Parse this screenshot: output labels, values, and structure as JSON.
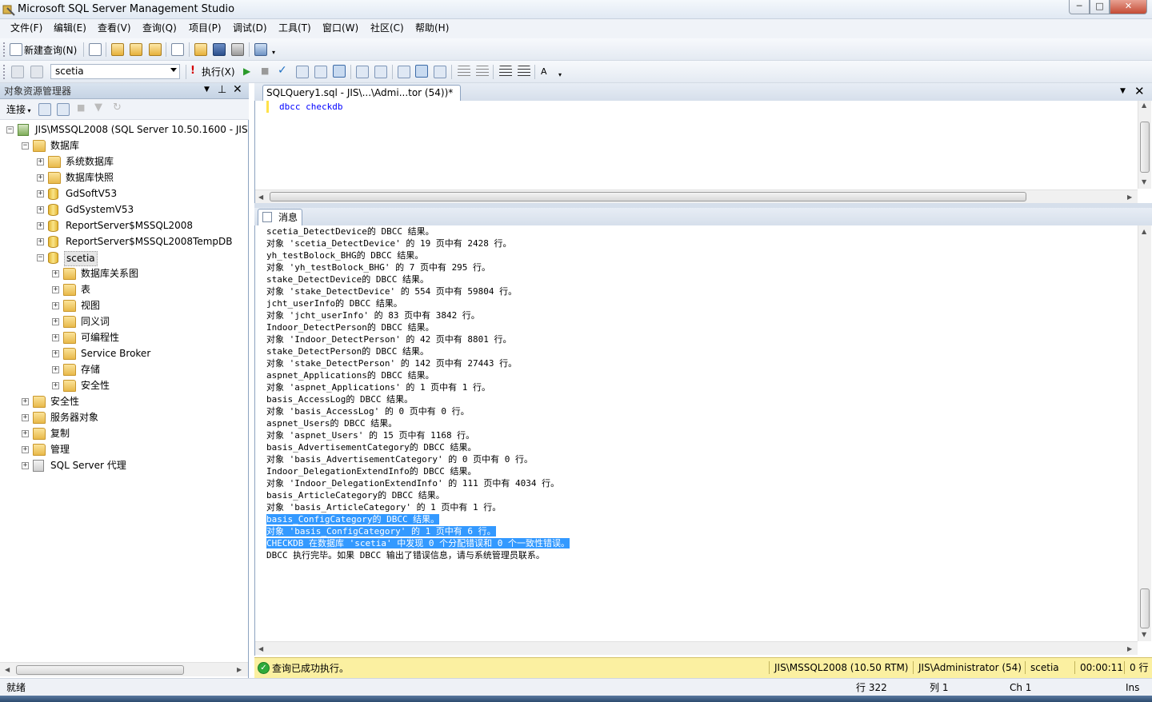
{
  "window": {
    "title": "Microsoft SQL Server Management Studio",
    "min": "─",
    "max": "□",
    "close": "✕"
  },
  "menu": [
    "文件(F)",
    "编辑(E)",
    "查看(V)",
    "查询(Q)",
    "项目(P)",
    "调试(D)",
    "工具(T)",
    "窗口(W)",
    "社区(C)",
    "帮助(H)"
  ],
  "toolbar1": {
    "new_query": "新建查询(N)"
  },
  "toolbar2": {
    "database": "scetia",
    "execute": "执行(X)"
  },
  "object_explorer": {
    "title": "对象资源管理器",
    "connect": "连接",
    "tree": [
      {
        "label": "JIS\\MSSQL2008 (SQL Server 10.50.1600 - JIS\\",
        "level": 0,
        "icon": "server-icon",
        "exp": "−"
      },
      {
        "label": "数据库",
        "level": 1,
        "icon": "folder-icon",
        "exp": "−"
      },
      {
        "label": "系统数据库",
        "level": 2,
        "icon": "folder-icon",
        "exp": "+"
      },
      {
        "label": "数据库快照",
        "level": 2,
        "icon": "folder-icon",
        "exp": "+"
      },
      {
        "label": "GdSoftV53",
        "level": 2,
        "icon": "database-icon",
        "exp": "+"
      },
      {
        "label": "GdSystemV53",
        "level": 2,
        "icon": "database-icon",
        "exp": "+"
      },
      {
        "label": "ReportServer$MSSQL2008",
        "level": 2,
        "icon": "database-icon",
        "exp": "+"
      },
      {
        "label": "ReportServer$MSSQL2008TempDB",
        "level": 2,
        "icon": "database-icon",
        "exp": "+"
      },
      {
        "label": "scetia",
        "level": 2,
        "icon": "database-icon",
        "exp": "−",
        "selected": true
      },
      {
        "label": "数据库关系图",
        "level": 3,
        "icon": "folder-icon",
        "exp": "+"
      },
      {
        "label": "表",
        "level": 3,
        "icon": "folder-icon",
        "exp": "+"
      },
      {
        "label": "视图",
        "level": 3,
        "icon": "folder-icon",
        "exp": "+"
      },
      {
        "label": "同义词",
        "level": 3,
        "icon": "folder-icon",
        "exp": "+"
      },
      {
        "label": "可编程性",
        "level": 3,
        "icon": "folder-icon",
        "exp": "+"
      },
      {
        "label": "Service Broker",
        "level": 3,
        "icon": "folder-icon",
        "exp": "+"
      },
      {
        "label": "存储",
        "level": 3,
        "icon": "folder-icon",
        "exp": "+"
      },
      {
        "label": "安全性",
        "level": 3,
        "icon": "folder-icon",
        "exp": "+"
      },
      {
        "label": "安全性",
        "level": 1,
        "icon": "folder-icon",
        "exp": "+"
      },
      {
        "label": "服务器对象",
        "level": 1,
        "icon": "folder-icon",
        "exp": "+"
      },
      {
        "label": "复制",
        "level": 1,
        "icon": "folder-icon",
        "exp": "+"
      },
      {
        "label": "管理",
        "level": 1,
        "icon": "folder-icon",
        "exp": "+"
      },
      {
        "label": "SQL Server 代理",
        "level": 1,
        "icon": "agent-icon",
        "exp": "+"
      }
    ]
  },
  "editor": {
    "tab": "SQLQuery1.sql - JIS\\...\\Admi...tor (54))*",
    "code": "dbcc checkdb"
  },
  "results": {
    "tab": "消息",
    "messages": [
      {
        "text": "scetia_DetectDevice的 DBCC 结果。"
      },
      {
        "text": "对象 'scetia_DetectDevice' 的 19 页中有 2428 行。"
      },
      {
        "text": "yh_testBolock_BHG的 DBCC 结果。"
      },
      {
        "text": "对象 'yh_testBolock_BHG' 的 7 页中有 295 行。"
      },
      {
        "text": "stake_DetectDevice的 DBCC 结果。"
      },
      {
        "text": "对象 'stake_DetectDevice' 的 554 页中有 59804 行。"
      },
      {
        "text": "jcht_userInfo的 DBCC 结果。"
      },
      {
        "text": "对象 'jcht_userInfo' 的 83 页中有 3842 行。"
      },
      {
        "text": "Indoor_DetectPerson的 DBCC 结果。"
      },
      {
        "text": "对象 'Indoor_DetectPerson' 的 42 页中有 8801 行。"
      },
      {
        "text": "stake_DetectPerson的 DBCC 结果。"
      },
      {
        "text": "对象 'stake_DetectPerson' 的 142 页中有 27443 行。"
      },
      {
        "text": "aspnet_Applications的 DBCC 结果。"
      },
      {
        "text": "对象 'aspnet_Applications' 的 1 页中有 1 行。"
      },
      {
        "text": "basis_AccessLog的 DBCC 结果。"
      },
      {
        "text": "对象 'basis_AccessLog' 的 0 页中有 0 行。"
      },
      {
        "text": "aspnet_Users的 DBCC 结果。"
      },
      {
        "text": "对象 'aspnet_Users' 的 15 页中有 1168 行。"
      },
      {
        "text": "basis_AdvertisementCategory的 DBCC 结果。"
      },
      {
        "text": "对象 'basis_AdvertisementCategory' 的 0 页中有 0 行。"
      },
      {
        "text": "Indoor_DelegationExtendInfo的 DBCC 结果。"
      },
      {
        "text": "对象 'Indoor_DelegationExtendInfo' 的 111 页中有 4034 行。"
      },
      {
        "text": "basis_ArticleCategory的 DBCC 结果。"
      },
      {
        "text": "对象 'basis_ArticleCategory' 的 1 页中有 1 行。"
      },
      {
        "text": "basis_ConfigCategory的 DBCC 结果。",
        "selected": true
      },
      {
        "text": "对象 'basis_ConfigCategory' 的 1 页中有 6 行。",
        "selected": true
      },
      {
        "text": "CHECKDB 在数据库 'scetia' 中发现 0 个分配错误和 0 个一致性错误。",
        "selected": true
      },
      {
        "text": "DBCC 执行完毕。如果 DBCC 输出了错误信息，请与系统管理员联系。"
      }
    ]
  },
  "status": {
    "message": "查询已成功执行。",
    "server": "JIS\\MSSQL2008 (10.50 RTM)",
    "user": "JIS\\Administrator (54)",
    "database": "scetia",
    "elapsed": "00:00:11",
    "rows": "0 行"
  },
  "app_status": {
    "ready": "就绪",
    "line": "行 322",
    "col": "列 1",
    "ch": "Ch 1",
    "mode": "Ins"
  },
  "colors": {
    "selection": "#3399ff",
    "status_bar": "#fbf0a1",
    "keyword": "#0000ff"
  }
}
